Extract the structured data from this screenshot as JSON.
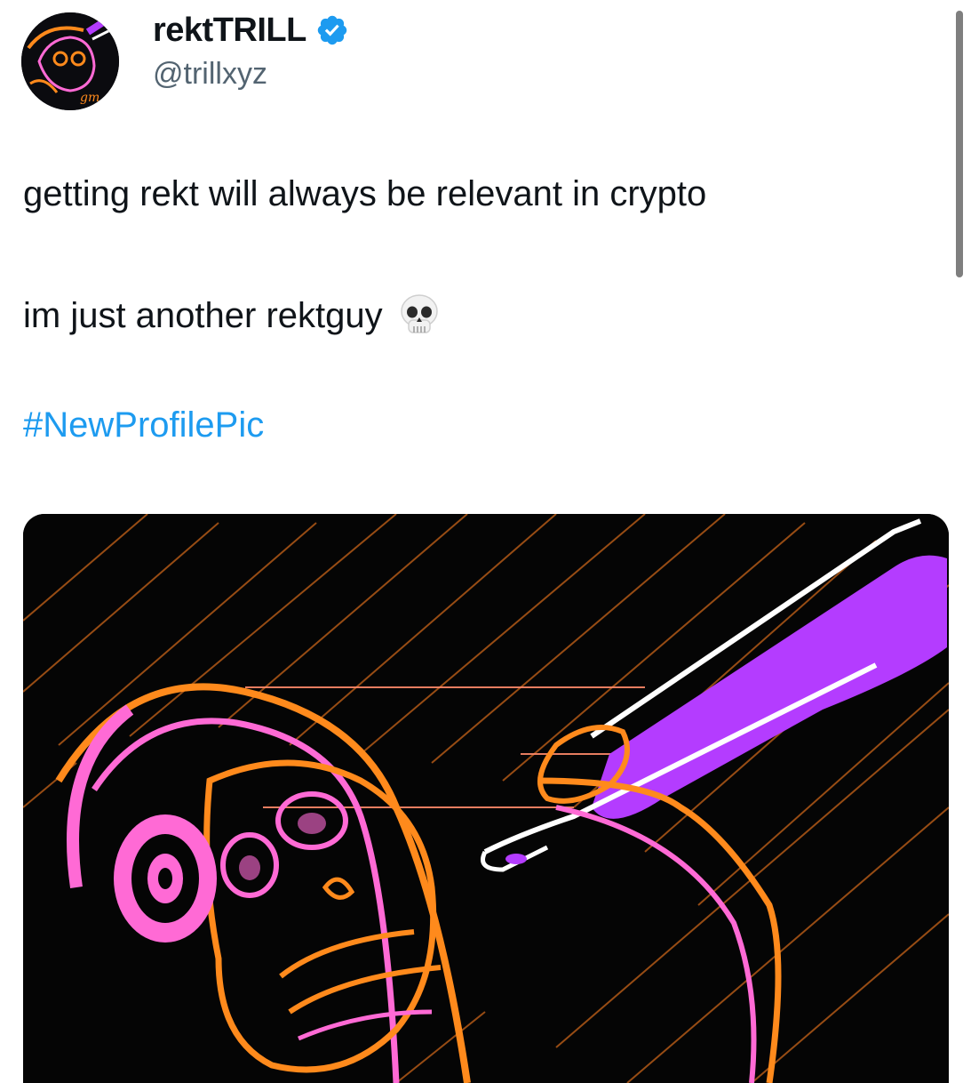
{
  "author": {
    "display_name": "rektTRILL",
    "handle": "@trillxyz",
    "verified": true,
    "avatar_caption": "gm"
  },
  "tweet": {
    "line1": "getting rekt will always be relevant in crypto",
    "line2": "im just another rektguy",
    "emoji": "skull",
    "hashtag": "#NewProfilePic"
  },
  "colors": {
    "verified_blue": "#1d9bf0",
    "link_blue": "#1d9bf0",
    "handle_gray": "#536471",
    "text": "#0f1419",
    "art_orange": "#ff8a1c",
    "art_pink": "#ff6ad5",
    "art_purple": "#b43cff"
  },
  "icons": {
    "verified": "verified-badge-icon",
    "scrollbar": "scrollbar"
  }
}
